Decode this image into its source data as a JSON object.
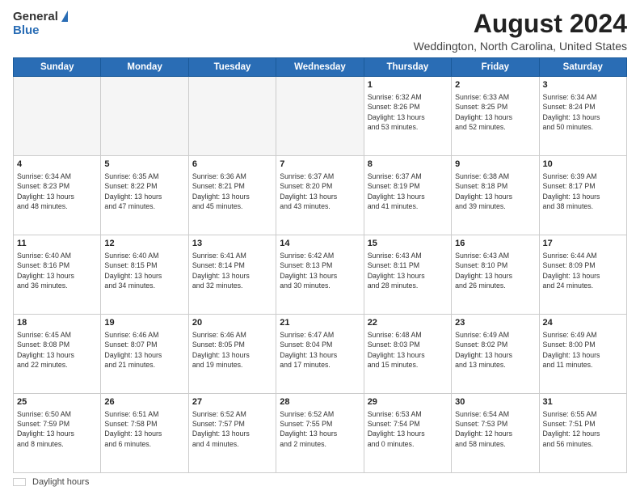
{
  "logo": {
    "general": "General",
    "blue": "Blue"
  },
  "title": "August 2024",
  "subtitle": "Weddington, North Carolina, United States",
  "days_of_week": [
    "Sunday",
    "Monday",
    "Tuesday",
    "Wednesday",
    "Thursday",
    "Friday",
    "Saturday"
  ],
  "legend": {
    "label": "Daylight hours"
  },
  "weeks": [
    [
      {
        "day": "",
        "info": ""
      },
      {
        "day": "",
        "info": ""
      },
      {
        "day": "",
        "info": ""
      },
      {
        "day": "",
        "info": ""
      },
      {
        "day": "1",
        "info": "Sunrise: 6:32 AM\nSunset: 8:26 PM\nDaylight: 13 hours\nand 53 minutes."
      },
      {
        "day": "2",
        "info": "Sunrise: 6:33 AM\nSunset: 8:25 PM\nDaylight: 13 hours\nand 52 minutes."
      },
      {
        "day": "3",
        "info": "Sunrise: 6:34 AM\nSunset: 8:24 PM\nDaylight: 13 hours\nand 50 minutes."
      }
    ],
    [
      {
        "day": "4",
        "info": "Sunrise: 6:34 AM\nSunset: 8:23 PM\nDaylight: 13 hours\nand 48 minutes."
      },
      {
        "day": "5",
        "info": "Sunrise: 6:35 AM\nSunset: 8:22 PM\nDaylight: 13 hours\nand 47 minutes."
      },
      {
        "day": "6",
        "info": "Sunrise: 6:36 AM\nSunset: 8:21 PM\nDaylight: 13 hours\nand 45 minutes."
      },
      {
        "day": "7",
        "info": "Sunrise: 6:37 AM\nSunset: 8:20 PM\nDaylight: 13 hours\nand 43 minutes."
      },
      {
        "day": "8",
        "info": "Sunrise: 6:37 AM\nSunset: 8:19 PM\nDaylight: 13 hours\nand 41 minutes."
      },
      {
        "day": "9",
        "info": "Sunrise: 6:38 AM\nSunset: 8:18 PM\nDaylight: 13 hours\nand 39 minutes."
      },
      {
        "day": "10",
        "info": "Sunrise: 6:39 AM\nSunset: 8:17 PM\nDaylight: 13 hours\nand 38 minutes."
      }
    ],
    [
      {
        "day": "11",
        "info": "Sunrise: 6:40 AM\nSunset: 8:16 PM\nDaylight: 13 hours\nand 36 minutes."
      },
      {
        "day": "12",
        "info": "Sunrise: 6:40 AM\nSunset: 8:15 PM\nDaylight: 13 hours\nand 34 minutes."
      },
      {
        "day": "13",
        "info": "Sunrise: 6:41 AM\nSunset: 8:14 PM\nDaylight: 13 hours\nand 32 minutes."
      },
      {
        "day": "14",
        "info": "Sunrise: 6:42 AM\nSunset: 8:13 PM\nDaylight: 13 hours\nand 30 minutes."
      },
      {
        "day": "15",
        "info": "Sunrise: 6:43 AM\nSunset: 8:11 PM\nDaylight: 13 hours\nand 28 minutes."
      },
      {
        "day": "16",
        "info": "Sunrise: 6:43 AM\nSunset: 8:10 PM\nDaylight: 13 hours\nand 26 minutes."
      },
      {
        "day": "17",
        "info": "Sunrise: 6:44 AM\nSunset: 8:09 PM\nDaylight: 13 hours\nand 24 minutes."
      }
    ],
    [
      {
        "day": "18",
        "info": "Sunrise: 6:45 AM\nSunset: 8:08 PM\nDaylight: 13 hours\nand 22 minutes."
      },
      {
        "day": "19",
        "info": "Sunrise: 6:46 AM\nSunset: 8:07 PM\nDaylight: 13 hours\nand 21 minutes."
      },
      {
        "day": "20",
        "info": "Sunrise: 6:46 AM\nSunset: 8:05 PM\nDaylight: 13 hours\nand 19 minutes."
      },
      {
        "day": "21",
        "info": "Sunrise: 6:47 AM\nSunset: 8:04 PM\nDaylight: 13 hours\nand 17 minutes."
      },
      {
        "day": "22",
        "info": "Sunrise: 6:48 AM\nSunset: 8:03 PM\nDaylight: 13 hours\nand 15 minutes."
      },
      {
        "day": "23",
        "info": "Sunrise: 6:49 AM\nSunset: 8:02 PM\nDaylight: 13 hours\nand 13 minutes."
      },
      {
        "day": "24",
        "info": "Sunrise: 6:49 AM\nSunset: 8:00 PM\nDaylight: 13 hours\nand 11 minutes."
      }
    ],
    [
      {
        "day": "25",
        "info": "Sunrise: 6:50 AM\nSunset: 7:59 PM\nDaylight: 13 hours\nand 8 minutes."
      },
      {
        "day": "26",
        "info": "Sunrise: 6:51 AM\nSunset: 7:58 PM\nDaylight: 13 hours\nand 6 minutes."
      },
      {
        "day": "27",
        "info": "Sunrise: 6:52 AM\nSunset: 7:57 PM\nDaylight: 13 hours\nand 4 minutes."
      },
      {
        "day": "28",
        "info": "Sunrise: 6:52 AM\nSunset: 7:55 PM\nDaylight: 13 hours\nand 2 minutes."
      },
      {
        "day": "29",
        "info": "Sunrise: 6:53 AM\nSunset: 7:54 PM\nDaylight: 13 hours\nand 0 minutes."
      },
      {
        "day": "30",
        "info": "Sunrise: 6:54 AM\nSunset: 7:53 PM\nDaylight: 12 hours\nand 58 minutes."
      },
      {
        "day": "31",
        "info": "Sunrise: 6:55 AM\nSunset: 7:51 PM\nDaylight: 12 hours\nand 56 minutes."
      }
    ]
  ]
}
